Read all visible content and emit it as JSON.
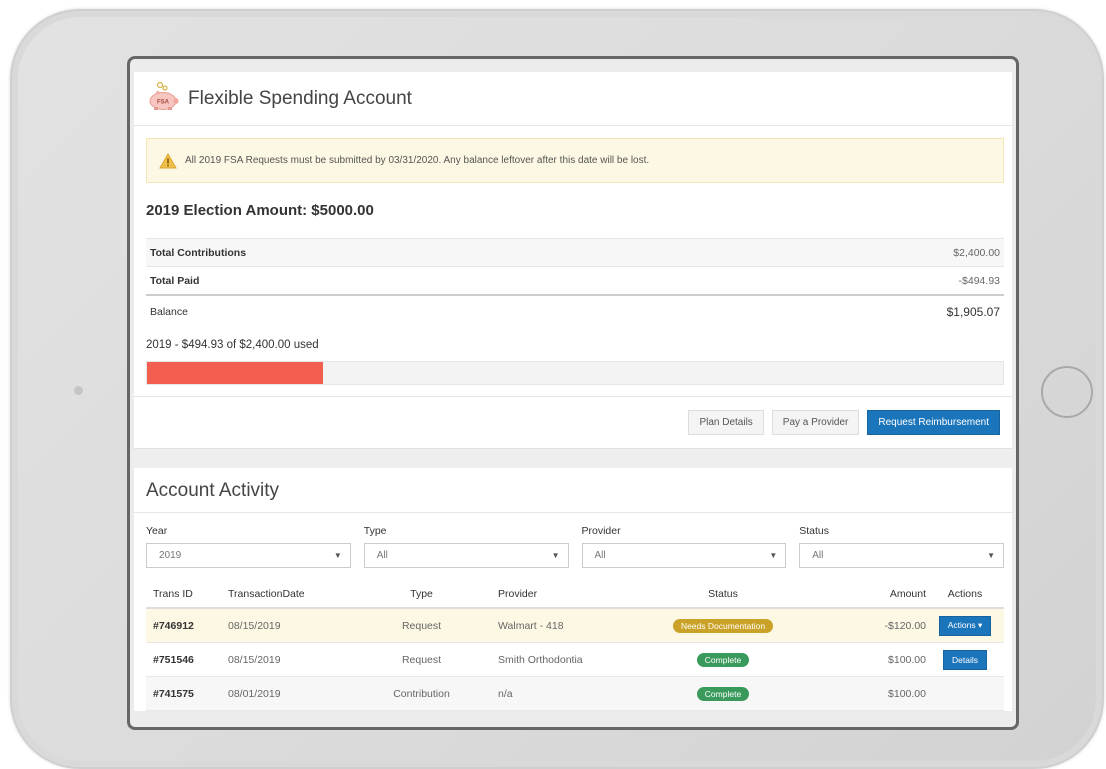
{
  "header": {
    "title": "Flexible Spending Account",
    "logo_icon": "piggy-bank-icon",
    "logo_text": "FSA"
  },
  "alert": {
    "icon": "warning-icon",
    "text": "All 2019 FSA Requests must be submitted by 03/31/2020. Any balance leftover after this date will be lost."
  },
  "election": {
    "text": "2019 Election Amount: $5000.00"
  },
  "summary": {
    "rows": [
      {
        "label": "Total Contributions",
        "value": "$2,400.00"
      },
      {
        "label": "Total Paid",
        "value": "-$494.93"
      },
      {
        "label": "Balance",
        "value": "$1,905.07"
      }
    ]
  },
  "usage": {
    "label": "2019 - $494.93 of $2,400.00 used",
    "fraction": 0.206
  },
  "buttons": {
    "plan_details": "Plan Details",
    "pay_provider": "Pay a Provider",
    "request_reimbursement": "Request Reimbursement"
  },
  "activity": {
    "title": "Account Activity",
    "filters": [
      {
        "label": "Year",
        "value": "2019"
      },
      {
        "label": "Type",
        "value": "All"
      },
      {
        "label": "Provider",
        "value": "All"
      },
      {
        "label": "Status",
        "value": "All"
      }
    ],
    "columns": [
      "Trans ID",
      "TransactionDate",
      "Type",
      "Provider",
      "Status",
      "Amount",
      "Actions"
    ],
    "rows": [
      {
        "id": "#746912",
        "date": "08/15/2019",
        "type": "Request",
        "provider": "Walmart - 418",
        "status": "Needs Documentation",
        "status_color": "#c9a227",
        "amount": "-$120.00",
        "action": "Actions ▾"
      },
      {
        "id": "#751546",
        "date": "08/15/2019",
        "type": "Request",
        "provider": "Smith Orthodontia",
        "status": "Complete",
        "status_color": "#3a9a5b",
        "amount": "$100.00",
        "action": "Details"
      },
      {
        "id": "#741575",
        "date": "08/01/2019",
        "type": "Contribution",
        "provider": "n/a",
        "status": "Complete",
        "status_color": "#3a9a5b",
        "amount": "$100.00",
        "action": ""
      }
    ]
  },
  "colors": {
    "primary": "#1b75bb",
    "progress": "#f25e50",
    "alert_bg": "#fcf8e3"
  }
}
